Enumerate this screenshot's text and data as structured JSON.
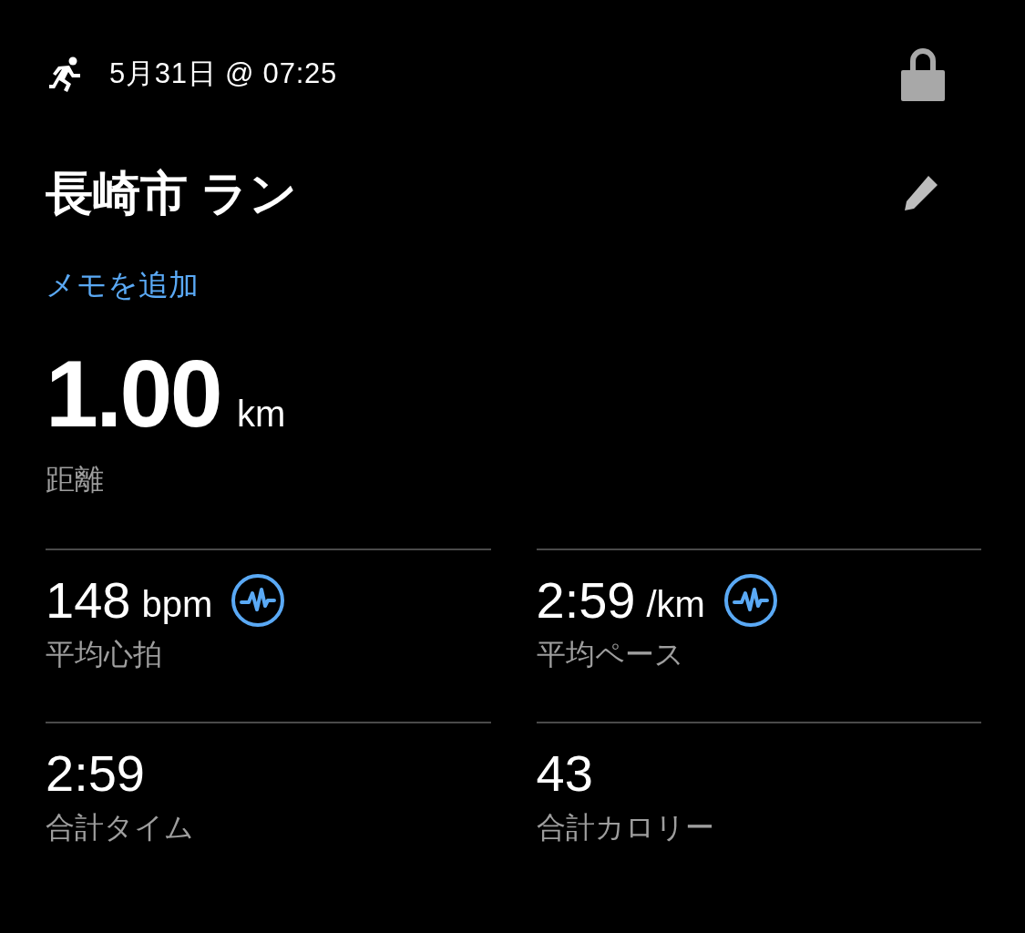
{
  "header": {
    "date_time": "5月31日 @ 07:25",
    "locked": true
  },
  "title": "長崎市 ラン",
  "memo_link": "メモを追加",
  "distance": {
    "value": "1.00",
    "unit": "km",
    "label": "距離"
  },
  "stats": [
    {
      "value": "148",
      "unit": "bpm",
      "label": "平均心拍",
      "sensor_icon": true
    },
    {
      "value": "2:59",
      "unit": "/km",
      "label": "平均ペース",
      "sensor_icon": true
    },
    {
      "value": "2:59",
      "label": "合計タイム",
      "sensor_icon": false
    },
    {
      "value": "43",
      "label": "合計カロリー",
      "sensor_icon": false
    }
  ]
}
